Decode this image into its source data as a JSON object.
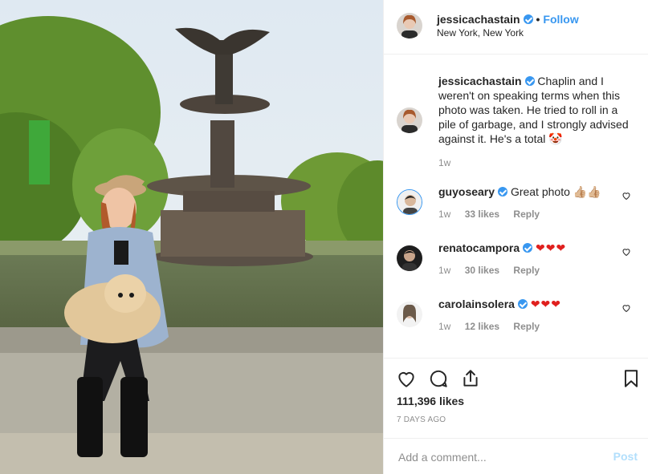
{
  "header": {
    "username": "jessicachastain",
    "follow_label": "Follow",
    "location": "New York, New York"
  },
  "caption": {
    "username": "jessicachastain",
    "text": "Chaplin and I weren't on speaking terms when this photo was taken. He tried to roll in a pile of garbage, and I strongly advised against it. He's a total",
    "emoji": "🤡",
    "time": "1w"
  },
  "comments": [
    {
      "username": "guyoseary",
      "text": "Great photo",
      "emoji": "👍🏼👍🏼",
      "time": "1w",
      "likes": "33 likes",
      "reply": "Reply"
    },
    {
      "username": "renatocampora",
      "text": "",
      "emoji": "❤❤❤",
      "time": "1w",
      "likes": "30 likes",
      "reply": "Reply"
    },
    {
      "username": "carolainsolera",
      "text": "",
      "emoji": "❤❤❤",
      "time": "1w",
      "likes": "12 likes",
      "reply": "Reply"
    }
  ],
  "stats": {
    "likes": "111,396 likes",
    "time_ago": "7 DAYS AGO"
  },
  "add_comment": {
    "placeholder": "Add a comment...",
    "post_label": "Post"
  },
  "icons": [
    "verified-badge-icon",
    "heart-icon",
    "comment-icon",
    "share-icon",
    "bookmark-icon"
  ],
  "colors": {
    "accent": "#3897f0",
    "text": "#262626",
    "muted": "#8e8e8e",
    "heart": "#ed4956"
  }
}
